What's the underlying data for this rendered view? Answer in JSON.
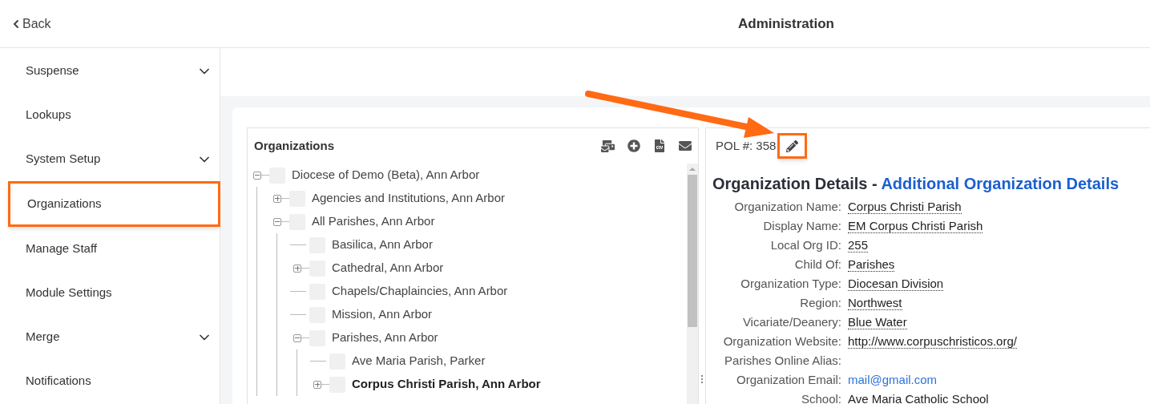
{
  "header": {
    "back": "Back",
    "title": "Administration"
  },
  "sidebar": {
    "items": [
      {
        "label": "Suspense",
        "has_submenu": true,
        "highlighted": false
      },
      {
        "label": "Lookups",
        "has_submenu": false,
        "highlighted": false
      },
      {
        "label": "System Setup",
        "has_submenu": true,
        "highlighted": false
      },
      {
        "label": "Organizations",
        "has_submenu": false,
        "highlighted": true
      },
      {
        "label": "Manage Staff",
        "has_submenu": false,
        "highlighted": false
      },
      {
        "label": "Module Settings",
        "has_submenu": false,
        "highlighted": false
      },
      {
        "label": "Merge",
        "has_submenu": true,
        "highlighted": false
      },
      {
        "label": "Notifications",
        "has_submenu": false,
        "highlighted": false
      }
    ]
  },
  "tree": {
    "title": "Organizations",
    "items": [
      {
        "label": "Diocese of Demo (Beta), Ann Arbor",
        "kind": "branch",
        "expanded": true,
        "selected": false,
        "checked": false,
        "children": [
          {
            "label": "Agencies and Institutions, Ann Arbor",
            "kind": "branch",
            "expanded": false,
            "selected": false,
            "checked": false
          },
          {
            "label": "All Parishes, Ann Arbor",
            "kind": "branch",
            "expanded": true,
            "selected": false,
            "checked": false,
            "children": [
              {
                "label": "Basilica, Ann Arbor",
                "kind": "leaf",
                "selected": false,
                "checked": false
              },
              {
                "label": "Cathedral, Ann Arbor",
                "kind": "branch",
                "expanded": false,
                "selected": false,
                "checked": false
              },
              {
                "label": "Chapels/Chaplaincies, Ann Arbor",
                "kind": "leaf",
                "selected": false,
                "checked": false
              },
              {
                "label": "Mission, Ann Arbor",
                "kind": "leaf",
                "selected": false,
                "checked": false
              },
              {
                "label": "Parishes, Ann Arbor",
                "kind": "branch",
                "expanded": true,
                "selected": false,
                "checked": false,
                "children": [
                  {
                    "label": "Ave Maria Parish, Parker",
                    "kind": "leaf",
                    "selected": false,
                    "checked": false
                  },
                  {
                    "label": "Corpus Christi Parish, Ann Arbor",
                    "kind": "branch",
                    "expanded": false,
                    "selected": true,
                    "checked": false
                  }
                ]
              }
            ]
          }
        ]
      }
    ]
  },
  "details": {
    "pol": "POL #: 358",
    "edit_highlighted": true,
    "heading": "Organization Details - ",
    "heading_link": "Additional Organization Details",
    "fields": [
      {
        "label": "Organization Name:",
        "value": "Corpus Christi Parish",
        "kind": "editable"
      },
      {
        "label": "Display Name:",
        "value": "EM Corpus Christi Parish",
        "kind": "editable"
      },
      {
        "label": "Local Org ID:",
        "value": "255",
        "kind": "editable"
      },
      {
        "label": "Child Of:",
        "value": "Parishes",
        "kind": "editable"
      },
      {
        "label": "Organization Type:",
        "value": "Diocesan Division",
        "kind": "editable"
      },
      {
        "label": "Region:",
        "value": "Northwest",
        "kind": "editable"
      },
      {
        "label": "Vicariate/Deanery:",
        "value": "Blue Water",
        "kind": "editable"
      },
      {
        "label": "Organization Website:",
        "value": "http://www.corpuschristicos.org/",
        "kind": "editable"
      },
      {
        "label": "Parishes Online Alias:",
        "kind": "empty"
      },
      {
        "label": "Organization Email:",
        "value": "mail@gmail.com",
        "kind": "link"
      },
      {
        "label": "School:",
        "value": "Ave Maria Catholic School",
        "kind": "editable"
      }
    ]
  }
}
